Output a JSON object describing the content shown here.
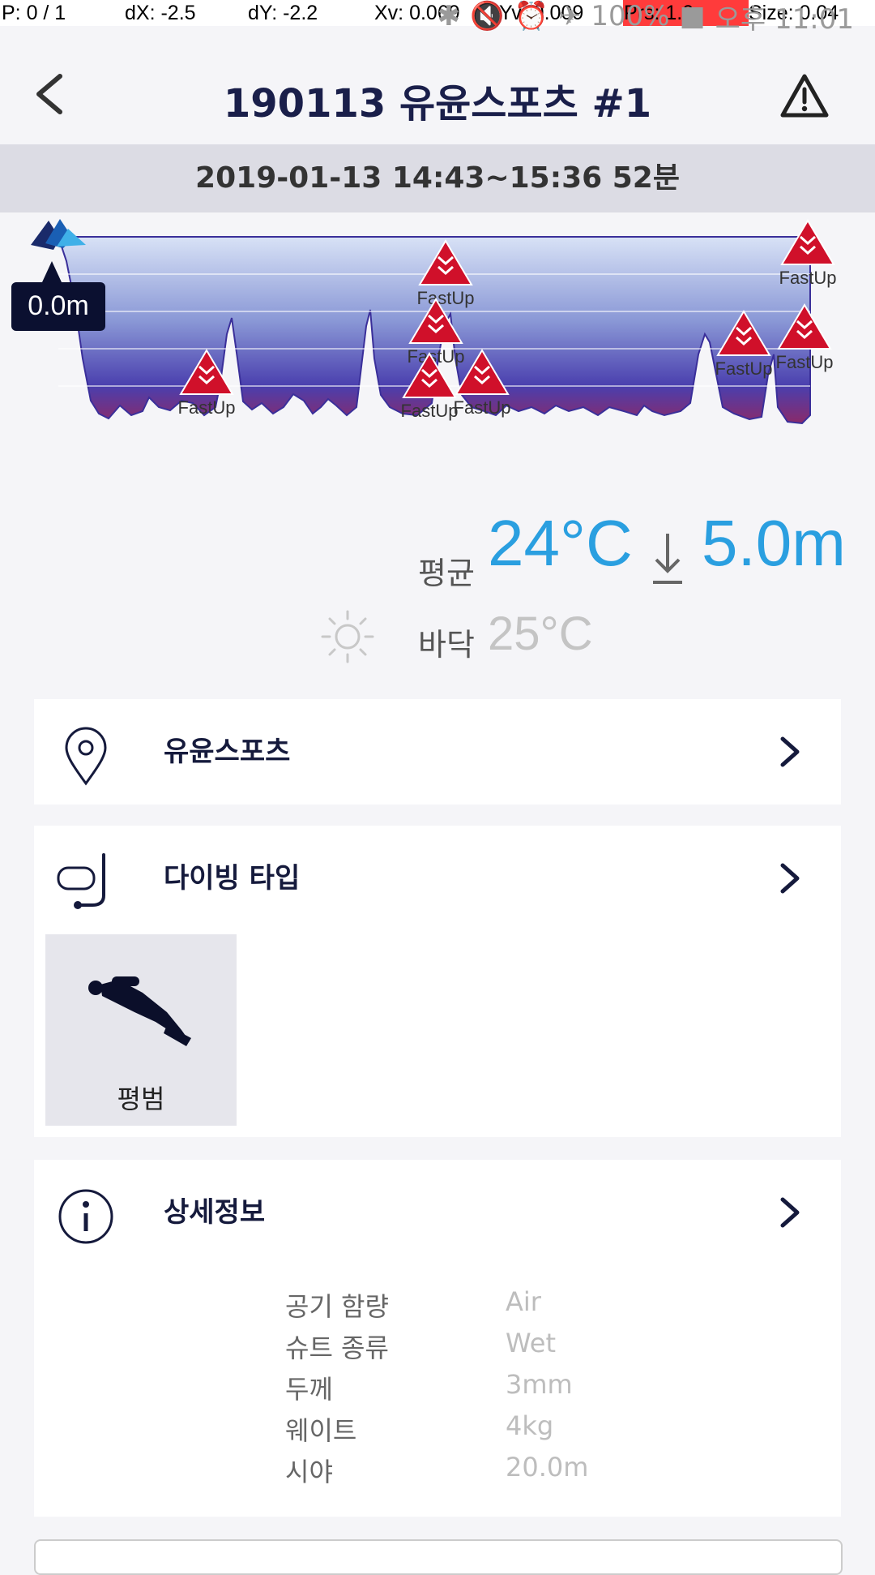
{
  "debug": {
    "p": "P: 0 / 1",
    "dx": "dX: -2.5",
    "dy": "dY: -2.2",
    "xv": "Xv: 0.069",
    "yv": "Yv: 0.009",
    "prs": "Prs: 1.0",
    "size": "Size: 0.04"
  },
  "status": {
    "battery": "100%",
    "time": "오후 11:01"
  },
  "header": {
    "title": "190113 유윤스포츠  #1"
  },
  "dive": {
    "datetime": "2019-01-13  14:43~15:36  52분",
    "depth_marker": "0.0m",
    "event_label": "FastUp",
    "avg_label": "평균",
    "avg_temp": "24°C",
    "max_depth": "5.0m",
    "bottom_label": "바닥",
    "bottom_temp": "25°C"
  },
  "cards": {
    "location": "유윤스포츠",
    "dive_type": "다이빙 타입",
    "dive_type_value": "평범",
    "details": "상세정보"
  },
  "details": [
    {
      "key": "공기 함량",
      "value": "Air"
    },
    {
      "key": "슈트 종류",
      "value": "Wet"
    },
    {
      "key": "두께",
      "value": "3mm"
    },
    {
      "key": "웨이트",
      "value": "4kg"
    },
    {
      "key": "시야",
      "value": "20.0m"
    }
  ],
  "colors": {
    "accent": "#2a9fe0",
    "navy": "#151a3c",
    "fastup": "#d0102a",
    "graph_top": "#c8d4f0",
    "graph_bottom": "#3a2f9a"
  }
}
